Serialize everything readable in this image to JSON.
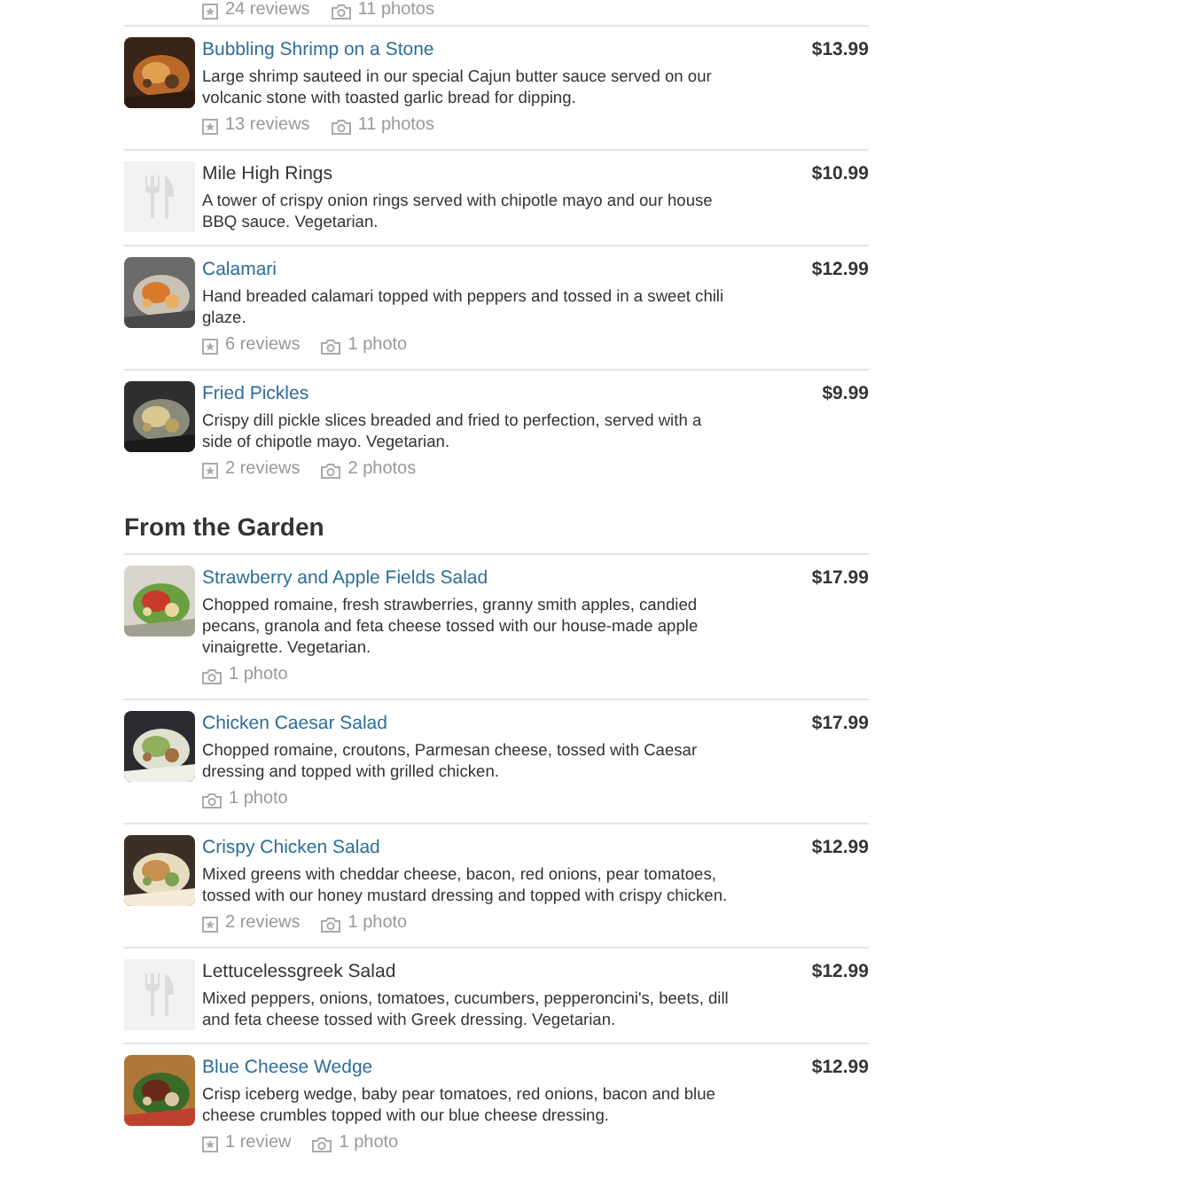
{
  "top_stats": {
    "reviews": "24 reviews",
    "photos": "11 photos"
  },
  "sections": [
    {
      "items": [
        {
          "name": "Bubbling Shrimp on a Stone",
          "price": "$13.99",
          "description": "Large shrimp sauteed in our special Cajun butter sauce served on our volcanic stone with toasted garlic bread for dipping.",
          "reviews": "13 reviews",
          "photos": "11 photos"
        },
        {
          "kind": "placeholder",
          "name": "Mile High Rings",
          "price": "$10.99",
          "description": "A tower of crispy onion rings served with chipotle mayo and our house BBQ sauce. Vegetarian."
        },
        {
          "name": "Calamari",
          "price": "$12.99",
          "description": "Hand breaded calamari topped with peppers and tossed in a sweet chili glaze.",
          "reviews": "6 reviews",
          "photos": "1 photo"
        },
        {
          "name": "Fried Pickles",
          "price": "$9.99",
          "description": "Crispy dill pickle slices breaded and fried to perfection, served with a side of chipotle mayo. Vegetarian.",
          "reviews": "2 reviews",
          "photos": "2 photos"
        }
      ]
    },
    {
      "title": "From the Garden",
      "items": [
        {
          "name": "Strawberry and Apple Fields Salad",
          "price": "$17.99",
          "description": "Chopped romaine, fresh strawberries, granny smith apples, candied pecans, granola and feta cheese tossed with our house-made apple vinaigrette. Vegetarian.",
          "photos": "1 photo"
        },
        {
          "name": "Chicken Caesar Salad",
          "price": "$17.99",
          "description": "Chopped romaine, croutons, Parmesan cheese, tossed with Caesar dressing and topped with grilled chicken.",
          "photos": "1 photo"
        },
        {
          "name": "Crispy Chicken Salad",
          "price": "$12.99",
          "description": "Mixed greens with cheddar cheese, bacon, red onions, pear tomatoes, tossed with our honey mustard dressing and topped with crispy chicken.",
          "reviews": "2 reviews",
          "photos": "1 photo"
        },
        {
          "kind": "placeholder",
          "name": "Lettucelessgreek Salad",
          "price": "$12.99",
          "description": "Mixed peppers, onions, tomatoes, cucumbers, pepperoncini's, beets, dill and feta cheese tossed with Greek dressing. Vegetarian."
        },
        {
          "name": "Blue Cheese Wedge",
          "price": "$12.99",
          "description": "Crisp iceberg wedge, baby pear tomatoes, red onions, bacon and blue cheese crumbles topped with our blue cheese dressing.",
          "reviews": "1 review",
          "photos": "1 photo"
        }
      ]
    }
  ]
}
